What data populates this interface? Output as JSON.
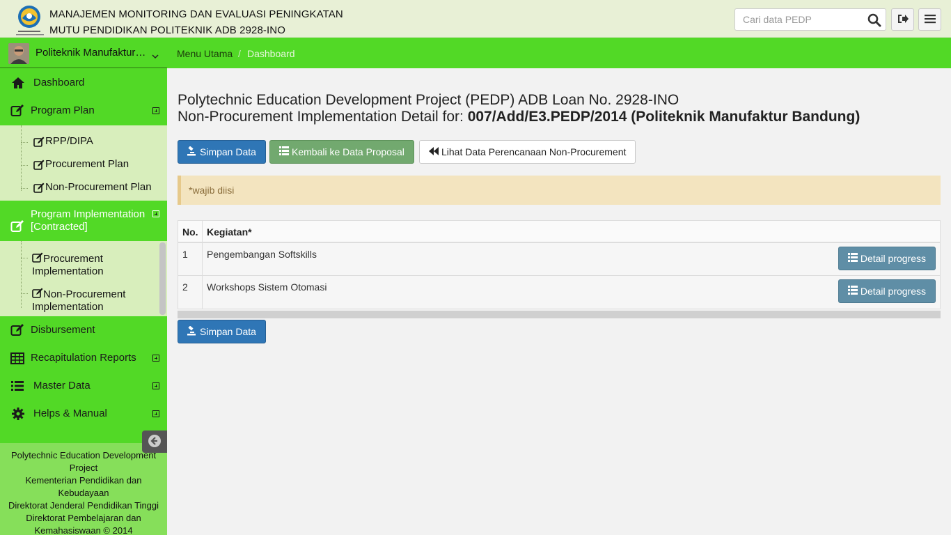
{
  "header": {
    "title_line1": "MANAJEMEN MONITORING DAN EVALUASI PENINGKATAN",
    "title_line2": "MUTU PENDIDIKAN POLITEKNIK ADB 2928-INO",
    "search_placeholder": "Cari data PEDP",
    "logo_icon": "ministry-logo-icon",
    "logout_icon": "sign-out-icon",
    "menu_icon": "hamburger-menu-icon"
  },
  "profile": {
    "name": "Politeknik Manufaktur Bandung"
  },
  "breadcrumb": {
    "home": "Menu Utama",
    "separator": "/",
    "current": "Dashboard"
  },
  "sidebar": {
    "dashboard": "Dashboard",
    "program_plan": "Program Plan",
    "program_plan_items": [
      "RPP/DIPA",
      "Procurement Plan",
      "Non-Procurement Plan"
    ],
    "program_impl_line1": "Program Implementation",
    "program_impl_line2": "[Contracted]",
    "program_impl_items": [
      {
        "line1": "Procurement",
        "line2": "Implementation"
      },
      {
        "line1": "Non-Procurement",
        "line2": "Implementation"
      }
    ],
    "disbursement": "Disbursement",
    "recap": "Recapitulation Reports",
    "master": "Master Data",
    "helps": "Helps & Manual"
  },
  "footer": {
    "line1": "Polytechnic Education Development",
    "line2": "Project",
    "line3": "Kementerian Pendidikan dan",
    "line4": "Kebudayaan",
    "line5": "Direktorat Jenderal Pendidikan Tinggi",
    "line6": "Direktorat Pembelajaran dan",
    "line7": "Kemahasiswaan © 2014"
  },
  "main": {
    "title_line1": "Polytechnic Education Development Project (PEDP) ADB Loan No. 2928-INO",
    "title_line2_prefix": "Non-Procurement Implementation Detail for:",
    "title_line2_bold": "007/Add/E3.PEDP/2014 (Politeknik Manufaktur Bandung)",
    "buttons": {
      "save": "Simpan Data",
      "back": "Kembali ke Data Proposal",
      "view_plan": "Lihat Data Perencanaan Non-Procurement",
      "save_bottom": "Simpan Data"
    },
    "alert": "*wajib diisi",
    "table": {
      "headers": [
        "No.",
        "Kegiatan*"
      ],
      "rows": [
        {
          "no": "1",
          "kegiatan": "Pengembangan Softskills",
          "action": "Detail progress"
        },
        {
          "no": "2",
          "kegiatan": "Workshops Sistem Otomasi",
          "action": "Detail progress"
        }
      ]
    }
  },
  "colors": {
    "sidebar_green": "#52d926",
    "submenu_bg": "#d8eebc",
    "primary_blue": "#2f76b6",
    "alert_bg": "#f3e4bf"
  }
}
